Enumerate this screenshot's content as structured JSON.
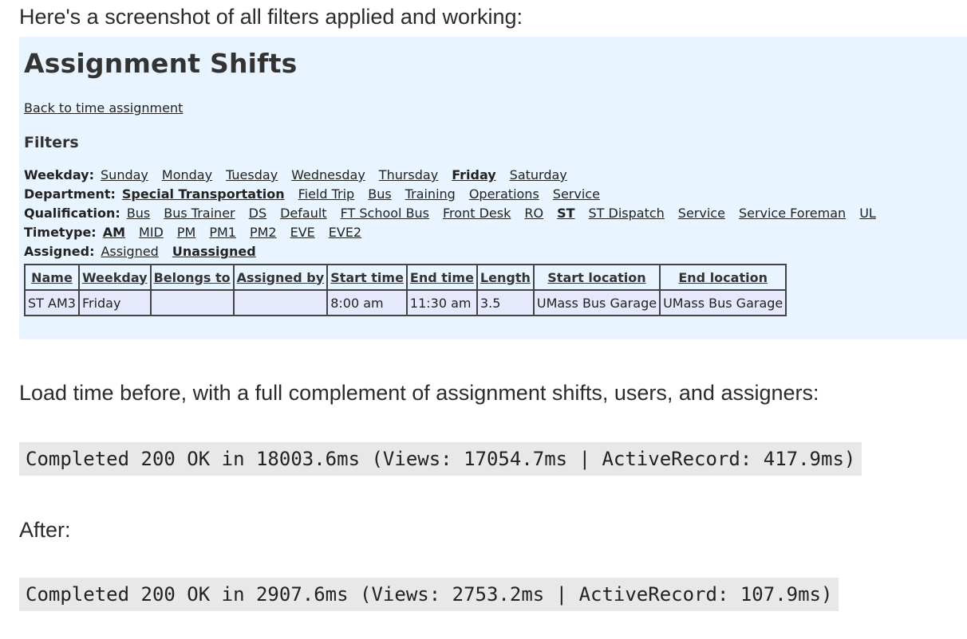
{
  "intro": "Here's a screenshot of all filters applied and working:",
  "panel": {
    "title": "Assignment Shifts",
    "back_link": "Back to time assignment",
    "filters_heading": "Filters",
    "filters": [
      {
        "label": "Weekday:",
        "options": [
          {
            "text": "Sunday",
            "selected": false
          },
          {
            "text": "Monday",
            "selected": false
          },
          {
            "text": "Tuesday",
            "selected": false
          },
          {
            "text": "Wednesday",
            "selected": false
          },
          {
            "text": "Thursday",
            "selected": false
          },
          {
            "text": "Friday",
            "selected": true
          },
          {
            "text": "Saturday",
            "selected": false
          }
        ]
      },
      {
        "label": "Department:",
        "options": [
          {
            "text": "Special Transportation",
            "selected": true
          },
          {
            "text": "Field Trip",
            "selected": false
          },
          {
            "text": "Bus",
            "selected": false
          },
          {
            "text": "Training",
            "selected": false
          },
          {
            "text": "Operations",
            "selected": false
          },
          {
            "text": "Service",
            "selected": false
          }
        ]
      },
      {
        "label": "Qualification:",
        "options": [
          {
            "text": "Bus",
            "selected": false
          },
          {
            "text": "Bus Trainer",
            "selected": false
          },
          {
            "text": "DS",
            "selected": false
          },
          {
            "text": "Default",
            "selected": false
          },
          {
            "text": "FT School Bus",
            "selected": false
          },
          {
            "text": "Front Desk",
            "selected": false
          },
          {
            "text": "RO",
            "selected": false
          },
          {
            "text": "ST",
            "selected": true
          },
          {
            "text": "ST Dispatch",
            "selected": false
          },
          {
            "text": "Service",
            "selected": false
          },
          {
            "text": "Service Foreman",
            "selected": false
          },
          {
            "text": "UL",
            "selected": false
          }
        ]
      },
      {
        "label": "Timetype:",
        "options": [
          {
            "text": "AM",
            "selected": true
          },
          {
            "text": "MID",
            "selected": false
          },
          {
            "text": "PM",
            "selected": false
          },
          {
            "text": "PM1",
            "selected": false
          },
          {
            "text": "PM2",
            "selected": false
          },
          {
            "text": "EVE",
            "selected": false
          },
          {
            "text": "EVE2",
            "selected": false
          }
        ]
      },
      {
        "label": "Assigned:",
        "options": [
          {
            "text": "Assigned",
            "selected": false
          },
          {
            "text": "Unassigned",
            "selected": true
          }
        ]
      }
    ],
    "table": {
      "headers": [
        "Name",
        "Weekday",
        "Belongs to",
        "Assigned by",
        "Start time",
        "End time",
        "Length",
        "Start location",
        "End location"
      ],
      "rows": [
        [
          "ST AM3",
          "Friday",
          "",
          "",
          "8:00 am",
          "11:30 am",
          "3.5",
          "UMass Bus Garage",
          "UMass Bus Garage"
        ]
      ]
    }
  },
  "load_before_text": "Load time before, with a full complement of assignment shifts, users, and assigners:",
  "log_before": "Completed 200 OK in 18003.6ms (Views: 17054.7ms | ActiveRecord: 417.9ms)",
  "after_text": "After:",
  "log_after": "Completed 200 OK in 2907.6ms (Views: 2753.2ms | ActiveRecord: 107.9ms)"
}
